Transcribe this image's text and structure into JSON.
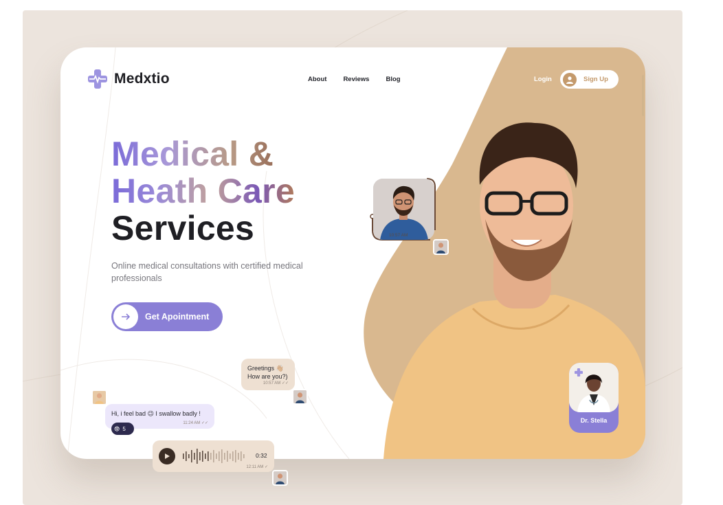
{
  "brand": {
    "name": "Medxtio",
    "accent": "#8a7fd6",
    "tan": "#d9b88f",
    "dark": "#1f1f24"
  },
  "nav": {
    "items": [
      "About",
      "Reviews",
      "Blog"
    ]
  },
  "auth": {
    "login_label": "Login",
    "signup_label": "Sign Up"
  },
  "hero": {
    "title_line1": "Medical &",
    "title_line2": "Heath Care",
    "title_line3": "Services",
    "subtitle": "Online medical consultations with certified medical professionals",
    "cta_label": "Get Apointment"
  },
  "video_call": {
    "time": "10:57 AM"
  },
  "doctor_card": {
    "name": "Dr. Stella"
  },
  "chat": {
    "greeting_line1": "Greetings 👋🏼",
    "greeting_line2": "How are you?)",
    "greeting_time": "10:57 AM",
    "patient_message": "Hi, i feel bad 😉 I swallow badly !",
    "patient_time": "11:24 AM",
    "reaction_emoji": "😨",
    "reaction_count": "5",
    "voice_duration": "0:32",
    "voice_time": "12:11 AM"
  }
}
